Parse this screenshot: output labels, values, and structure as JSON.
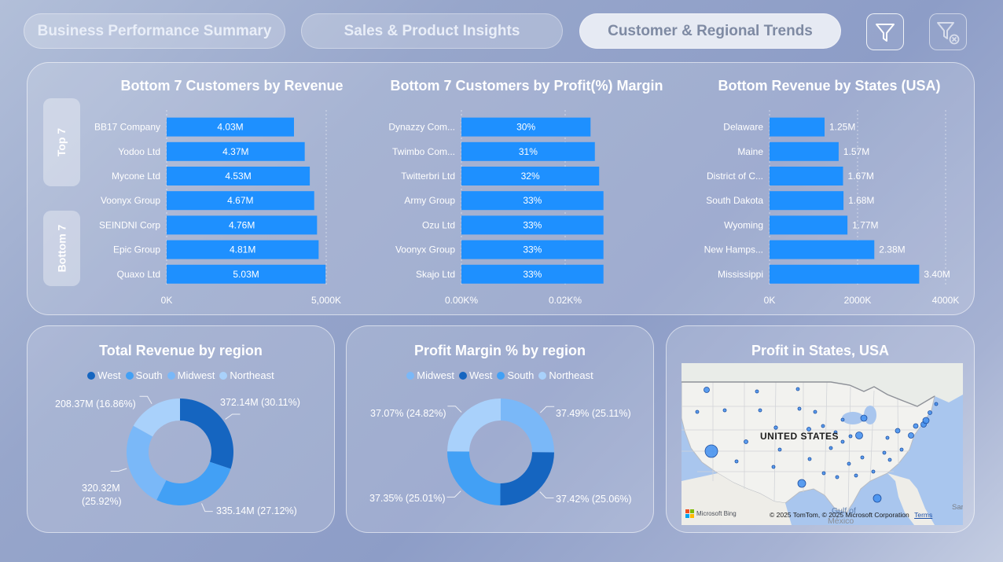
{
  "tabs": [
    {
      "label": "Business Performance Summary",
      "active": false
    },
    {
      "label": "Sales & Product Insights",
      "active": false
    },
    {
      "label": "Customer & Regional Trends",
      "active": true
    }
  ],
  "toolbar": {
    "filter_icon": "filter-icon",
    "clear_filter_icon": "clear-filter-icon"
  },
  "side_buttons": {
    "top": "Top 7",
    "bottom": "Bottom 7"
  },
  "colors": {
    "bar": "#1e90ff",
    "d1": "#1565c0",
    "d2": "#42a0f5",
    "d3": "#7ab8f8",
    "d4": "#a9d1fb"
  },
  "chart_data": [
    {
      "id": "rev",
      "type": "bar",
      "orientation": "horizontal",
      "title": "Bottom 7 Customers by Revenue",
      "categories": [
        "BB17 Company",
        "Yodoo Ltd",
        "Mycone Ltd",
        "Voonyx Group",
        "SEINDNI Corp",
        "Epic Group",
        "Quaxo Ltd"
      ],
      "values": [
        4.03,
        4.37,
        4.53,
        4.67,
        4.76,
        4.81,
        5.03
      ],
      "value_labels": [
        "4.03M",
        "4.37M",
        "4.53M",
        "4.67M",
        "4.76M",
        "4.81M",
        "5.03M"
      ],
      "xlim": [
        0,
        5.05
      ],
      "xticks": [
        "0K",
        "5,000K"
      ],
      "label_position": "inside"
    },
    {
      "id": "margin",
      "type": "bar",
      "orientation": "horizontal",
      "title": "Bottom 7 Customers by Profit(%) Margin",
      "categories": [
        "Dynazzy Com...",
        "Twimbo Com...",
        "Twitterbri Ltd",
        "Army Group",
        "Ozu Ltd",
        "Voonyx Group",
        "Skajo Ltd"
      ],
      "values": [
        30,
        31,
        32,
        33,
        33,
        33,
        33
      ],
      "value_labels": [
        "30%",
        "31%",
        "32%",
        "33%",
        "33%",
        "33%",
        "33%"
      ],
      "xlim": [
        0,
        42
      ],
      "xticks": [
        "0.00K%",
        "0.02K%"
      ],
      "label_position": "inside"
    },
    {
      "id": "states",
      "type": "bar",
      "orientation": "horizontal",
      "title": "Bottom Revenue by States (USA)",
      "categories": [
        "Delaware",
        "Maine",
        "District of C...",
        "South Dakota",
        "Wyoming",
        "New Hamps...",
        "Mississippi"
      ],
      "values": [
        1.25,
        1.57,
        1.67,
        1.68,
        1.77,
        2.38,
        3.4
      ],
      "value_labels": [
        "1.25M",
        "1.57M",
        "1.67M",
        "1.68M",
        "1.77M",
        "2.38M",
        "3.40M"
      ],
      "xlim": [
        0,
        4.0
      ],
      "xticks": [
        "0K",
        "2000K",
        "4000K"
      ],
      "label_position": "outside"
    },
    {
      "id": "regrev",
      "type": "pie",
      "donut": true,
      "title": "Total Revenue by region",
      "categories": [
        "West",
        "South",
        "Midwest",
        "Northeast"
      ],
      "values": [
        372.14,
        335.14,
        320.32,
        208.37
      ],
      "value_labels": [
        "372.14M (30.11%)",
        "335.14M (27.12%)",
        "320.32M (25.92%)",
        "208.37M (16.86%)"
      ],
      "legend": "top"
    },
    {
      "id": "regmargin",
      "type": "pie",
      "donut": true,
      "title": "Profit Margin % by region",
      "categories": [
        "Midwest",
        "West",
        "South",
        "Northeast"
      ],
      "values": [
        37.49,
        37.42,
        37.35,
        37.07
      ],
      "value_labels": [
        "37.49% (25.11%)",
        "37.42% (25.06%)",
        "37.35% (25.01%)",
        "37.07% (24.82%)"
      ],
      "legend": "top"
    }
  ],
  "map": {
    "title": "Profit in States, USA",
    "country_label": "UNITED STATES",
    "gulf_label": "Gulf of",
    "mexico_label": "México",
    "sar_label": "Sar",
    "brand": "Microsoft Bing",
    "attribution": "© 2025 TomTom, © 2025 Microsoft Corporation",
    "terms": "Terms"
  }
}
